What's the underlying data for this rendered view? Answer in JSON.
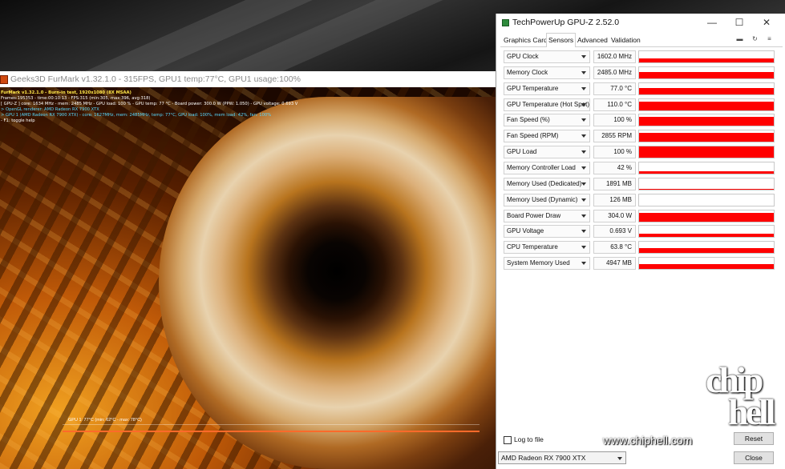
{
  "furmark": {
    "title": "Geeks3D FurMark v1.32.1.0 - 315FPS, GPU1 temp:77°C, GPU1 usage:100%",
    "osd_lines": [
      {
        "text": "FurMark v1.32.1.0 - Burn-in test, 1920x1080 (8X MSAA)",
        "color": "yellow"
      },
      {
        "text": "Frames:195353 - time:00:10:13 - FPS:315 (min:305, max:396, avg:318)",
        "color": "white"
      },
      {
        "text": "[ GPU-Z ] core: 1634 MHz - mem: 2485 MHz - GPU load: 100 % - GPU temp: 77 °C - Board power: 300.0 W (PPW: 1.050) - GPU voltage: 0.693 V",
        "color": "white"
      },
      {
        "text": "> OpenGL renderer: AMD Radeon RX 7900 XTX",
        "color": "cyan"
      },
      {
        "text": "> GPU 1 (AMD Radeon RX 7900 XTX) - core: 1627MHz, mem: 2485MHz, temp: 77°C, GPU load: 100%, mem load: 42%, fan: 100%",
        "color": "cyan"
      },
      {
        "text": "- F1: toggle help",
        "color": "white"
      }
    ],
    "temp_graph_label": "GPU 1: 77°C (min: 62°C - max: 78°C)"
  },
  "gpuz": {
    "title": "TechPowerUp GPU-Z 2.52.0",
    "window_buttons": {
      "minimize": "—",
      "maximize": "☐",
      "close": "✕"
    },
    "tabs": [
      "Graphics Card",
      "Sensors",
      "Advanced",
      "Validation"
    ],
    "active_tab": "Sensors",
    "toolbar_icons": [
      "camera-icon",
      "refresh-icon",
      "menu-icon"
    ],
    "toolbar_glyphs": [
      "▬",
      "↻",
      "≡"
    ],
    "graph_color": "#ff0000",
    "sensors": [
      {
        "name": "GPU Clock",
        "value": "1602.0 MHz",
        "level": 0.36
      },
      {
        "name": "Memory Clock",
        "value": "2485.0 MHz",
        "level": 0.6
      },
      {
        "name": "GPU Temperature",
        "value": "77.0 °C",
        "level": 0.55
      },
      {
        "name": "GPU Temperature (Hot Spot)",
        "value": "110.0 °C",
        "level": 0.8
      },
      {
        "name": "Fan Speed (%)",
        "value": "100 %",
        "level": 0.82
      },
      {
        "name": "Fan Speed (RPM)",
        "value": "2855 RPM",
        "level": 0.82
      },
      {
        "name": "GPU Load",
        "value": "100 %",
        "level": 1.0
      },
      {
        "name": "Memory Controller Load",
        "value": "42 %",
        "level": 0.22
      },
      {
        "name": "Memory Used (Dedicated)",
        "value": "1891 MB",
        "level": 0.06
      },
      {
        "name": "Memory Used (Dynamic)",
        "value": "126 MB",
        "level": 0.0
      },
      {
        "name": "Board Power Draw",
        "value": "304.0 W",
        "level": 0.75
      },
      {
        "name": "GPU Voltage",
        "value": "0.693 V",
        "level": 0.32
      },
      {
        "name": "CPU Temperature",
        "value": "63.8 °C",
        "level": 0.45
      },
      {
        "name": "System Memory Used",
        "value": "4947 MB",
        "level": 0.4
      }
    ],
    "log_to_file_label": "Log to file",
    "log_to_file_checked": false,
    "reset_label": "Reset",
    "gpu_select_value": "AMD Radeon RX 7900 XTX",
    "close_label": "Close"
  },
  "watermark": {
    "logo_text": "chip hell",
    "url": "www.chiphell.com"
  }
}
